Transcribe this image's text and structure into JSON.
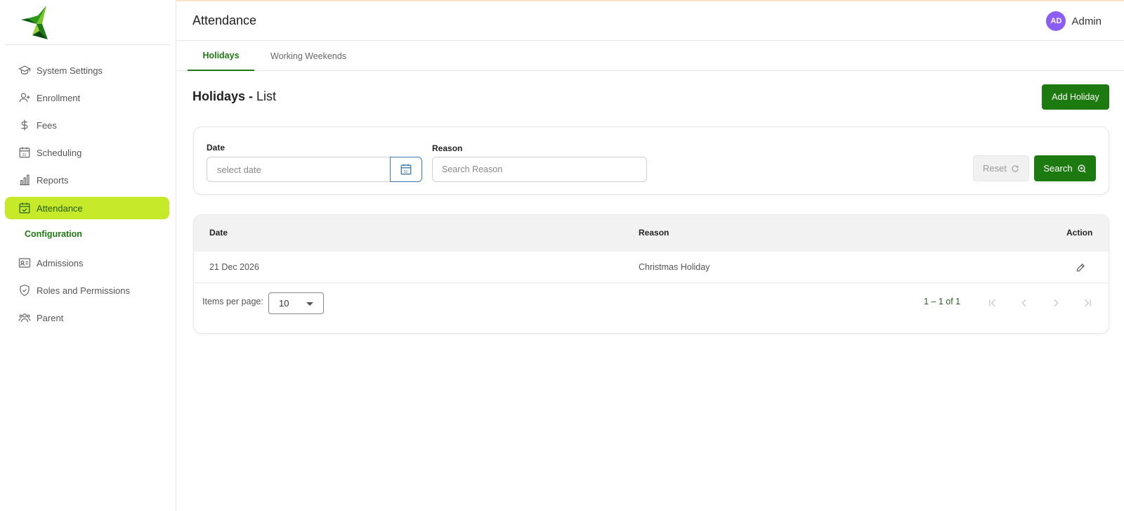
{
  "sidebar": {
    "items": [
      {
        "label": "System Settings",
        "icon": "graduation-cap-icon"
      },
      {
        "label": "Enrollment",
        "icon": "user-plus-icon"
      },
      {
        "label": "Fees",
        "icon": "dollar-icon"
      },
      {
        "label": "Scheduling",
        "icon": "calendar-31-icon"
      },
      {
        "label": "Reports",
        "icon": "bar-chart-icon"
      },
      {
        "label": "Attendance",
        "icon": "calendar-check-icon",
        "active": true
      },
      {
        "label": "Admissions",
        "icon": "id-card-icon"
      },
      {
        "label": "Roles and Permissions",
        "icon": "shield-check-icon"
      },
      {
        "label": "Parent",
        "icon": "users-icon"
      }
    ],
    "subitem": "Configuration"
  },
  "header": {
    "title": "Attendance",
    "user": {
      "initials": "AD",
      "name": "Admin"
    }
  },
  "tabs": [
    {
      "label": "Holidays",
      "active": true
    },
    {
      "label": "Working Weekends",
      "active": false
    }
  ],
  "section": {
    "title_bold": "Holidays -",
    "title_rest": " List",
    "add_button": "Add Holiday"
  },
  "filters": {
    "date_label": "Date",
    "date_placeholder": "select date",
    "reason_label": "Reason",
    "reason_placeholder": "Search Reason",
    "reset_label": "Reset",
    "search_label": "Search"
  },
  "table": {
    "columns": [
      "Date",
      "Reason",
      "Action"
    ],
    "rows": [
      {
        "date": "21 Dec 2026",
        "reason": "Christmas Holiday"
      }
    ]
  },
  "pagination": {
    "items_per_page_label": "Items per page:",
    "items_per_page": "10",
    "range": "1 – 1 of 1"
  },
  "colors": {
    "primary": "#1d7a10",
    "active_nav": "#c6e92a",
    "avatar": "#8b5cf6"
  }
}
